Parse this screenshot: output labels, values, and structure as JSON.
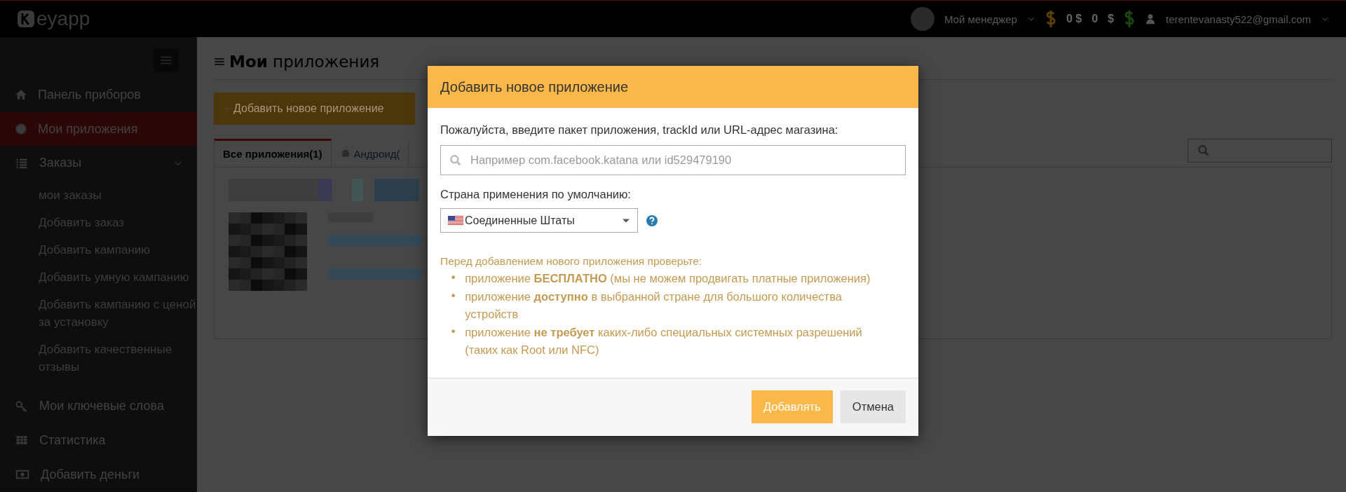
{
  "topbar": {
    "logo": "eyapp",
    "manager": "Мой менеджер",
    "balance": "0 $",
    "bonus": "0",
    "bonus_unit": "$",
    "email": "terentevanasty522@gmail.com"
  },
  "sidebar": {
    "items": [
      {
        "label": "Панель приборов",
        "selected": false
      },
      {
        "label": "Мои приложения",
        "selected": true
      },
      {
        "label": "Заказы",
        "selected": false,
        "expanded": true,
        "children": [
          {
            "label": "мои заказы"
          },
          {
            "label": "Добавить заказ"
          },
          {
            "label": "Добавить кампанию"
          },
          {
            "label": "Добавить умную кампанию"
          },
          {
            "label": "Добавить кампанию с ценой за установку"
          },
          {
            "label": "Добавить качественные отзывы"
          }
        ]
      },
      {
        "label": "Мои ключевые слова",
        "selected": false
      },
      {
        "label": "Статистика",
        "selected": false
      },
      {
        "label": "Добавить деньги",
        "selected": false
      }
    ]
  },
  "main": {
    "heading": "**Мои** приложения",
    "add_button": "Добавить новое приложение",
    "tabs": [
      {
        "label": "Все приложения(1)",
        "selected": true
      },
      {
        "label": "Андроид(",
        "selected": false
      }
    ]
  },
  "dialog": {
    "title": "Добавить новое приложение",
    "package_label": "Пожалуйста, введите пакет приложения, trackId или URL-адрес магазина:",
    "package_placeholder": "Например com.facebook.katana или id529479190",
    "country_label": "Страна применения по умолчанию:",
    "country": "Соединенные Штаты",
    "note": "Перед добавлением нового приложения проверьте:",
    "bullet": "•",
    "checks": [
      "приложение **БЕСПЛАТНО** (мы не можем продвигать платные приложения)",
      "приложение **доступно** в выбранной стране для большого количества устройств",
      "приложение **не требует** каких-либо специальных системных разрешений (таких как Root или NFC)"
    ],
    "buttons": [
      {
        "label": "Добавлять",
        "kind": "primary"
      },
      {
        "label": "Отмена",
        "kind": "secondary"
      }
    ]
  }
}
